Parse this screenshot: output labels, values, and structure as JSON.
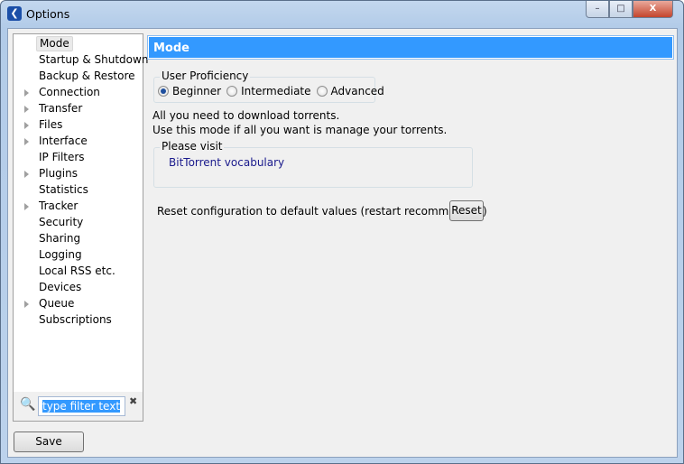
{
  "window": {
    "title": "Options",
    "controls": {
      "minimize": "–",
      "maximize": "□",
      "close": "X"
    }
  },
  "sidebar": {
    "items": [
      {
        "label": "Mode",
        "expandable": false,
        "selected": true
      },
      {
        "label": "Startup & Shutdown",
        "expandable": false
      },
      {
        "label": "Backup & Restore",
        "expandable": false
      },
      {
        "label": "Connection",
        "expandable": true
      },
      {
        "label": "Transfer",
        "expandable": true
      },
      {
        "label": "Files",
        "expandable": true
      },
      {
        "label": "Interface",
        "expandable": true
      },
      {
        "label": "IP Filters",
        "expandable": false
      },
      {
        "label": "Plugins",
        "expandable": true
      },
      {
        "label": "Statistics",
        "expandable": false
      },
      {
        "label": "Tracker",
        "expandable": true
      },
      {
        "label": "Security",
        "expandable": false
      },
      {
        "label": "Sharing",
        "expandable": false
      },
      {
        "label": "Logging",
        "expandable": false
      },
      {
        "label": "Local RSS etc.",
        "expandable": false
      },
      {
        "label": "Devices",
        "expandable": false
      },
      {
        "label": "Queue",
        "expandable": true
      },
      {
        "label": "Subscriptions",
        "expandable": false
      }
    ],
    "filter": {
      "value": "type filter text",
      "clear": "✖"
    }
  },
  "footer": {
    "save_label": "Save"
  },
  "main": {
    "header": "Mode",
    "proficiency": {
      "legend": "User Proficiency",
      "options": [
        "Beginner",
        "Intermediate",
        "Advanced"
      ],
      "selected": "Beginner"
    },
    "description": [
      "All you need to download torrents.",
      "Use this mode if all you want is manage your torrents."
    ],
    "visit": {
      "legend": "Please visit",
      "link": "BitTorrent vocabulary"
    },
    "reset": {
      "label": "Reset configuration to default values (restart recommended)",
      "button": "Reset"
    }
  },
  "colors": {
    "accent": "#3399ff",
    "link": "#1a1a8c"
  }
}
